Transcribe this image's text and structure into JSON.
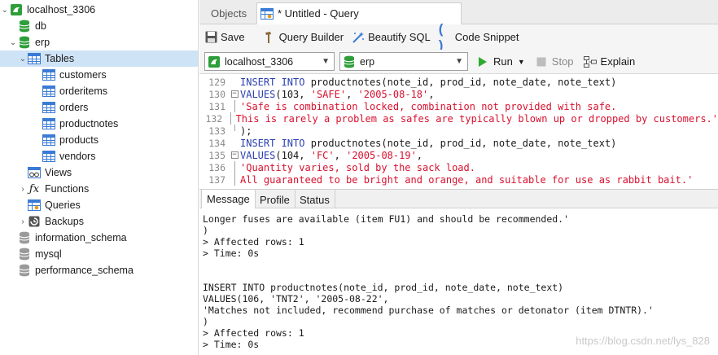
{
  "sidebar": {
    "connection": "localhost_3306",
    "db": "db",
    "erp": "erp",
    "tables": "Tables",
    "tables_list": [
      "customers",
      "orderitems",
      "orders",
      "productnotes",
      "products",
      "vendors"
    ],
    "views": "Views",
    "functions": "Functions",
    "queries": "Queries",
    "backups": "Backups",
    "other_dbs": [
      "information_schema",
      "mysql",
      "performance_schema"
    ]
  },
  "tabs": {
    "objects": "Objects",
    "query": "* Untitled - Query"
  },
  "toolbar": {
    "save": "Save",
    "query_builder": "Query Builder",
    "beautify": "Beautify SQL",
    "snippet": "Code Snippet"
  },
  "connbar": {
    "connection": "localhost_3306",
    "database": "erp",
    "run": "Run",
    "stop": "Stop",
    "explain": "Explain"
  },
  "editor": {
    "lines": [
      {
        "n": "129",
        "kw1": "INSERT INTO",
        "rest": " productnotes(note_id, prod_id, note_date, note_text)"
      },
      {
        "n": "130",
        "kw1": "VALUES",
        "p1": "(",
        "num": "103",
        "sep": ", ",
        "s1": "'SAFE'",
        "sep2": ", ",
        "s2": "'2005-08-18'",
        "end": ","
      },
      {
        "n": "131",
        "str": "'Safe is combination locked, combination not provided with safe."
      },
      {
        "n": "132",
        "str": "This is rarely a problem as safes are typically blown up or dropped by customers.'"
      },
      {
        "n": "133",
        "code": ");"
      },
      {
        "n": "134",
        "kw1": "INSERT INTO",
        "rest": " productnotes(note_id, prod_id, note_date, note_text)"
      },
      {
        "n": "135",
        "kw1": "VALUES",
        "p1": "(",
        "num": "104",
        "sep": ", ",
        "s1": "'FC'",
        "sep2": ", ",
        "s2": "'2005-08-19'",
        "end": ","
      },
      {
        "n": "136",
        "str": "'Quantity varies, sold by the sack load."
      },
      {
        "n": "137",
        "str": "All guaranteed to be bright and orange, and suitable for use as rabbit bait.'"
      }
    ]
  },
  "result_tabs": [
    "Message",
    "Profile",
    "Status"
  ],
  "messages": [
    "Longer fuses are available (item FU1) and should be recommended.'",
    ")",
    "> Affected rows: 1",
    "> Time: 0s",
    "",
    "",
    "INSERT INTO productnotes(note_id, prod_id, note_date, note_text)",
    "VALUES(106, 'TNT2', '2005-08-22',",
    "'Matches not included, recommend purchase of matches or detonator (item DTNTR).'",
    ")",
    "> Affected rows: 1",
    "> Time: 0s"
  ],
  "watermark": "https://blog.csdn.net/lys_828",
  "colors": {
    "keyword": "#2a3fb0",
    "string": "#d8102e",
    "selection": "#cfe3f7",
    "db_green": "#2e9e3a",
    "run_green": "#2eaa2e"
  }
}
